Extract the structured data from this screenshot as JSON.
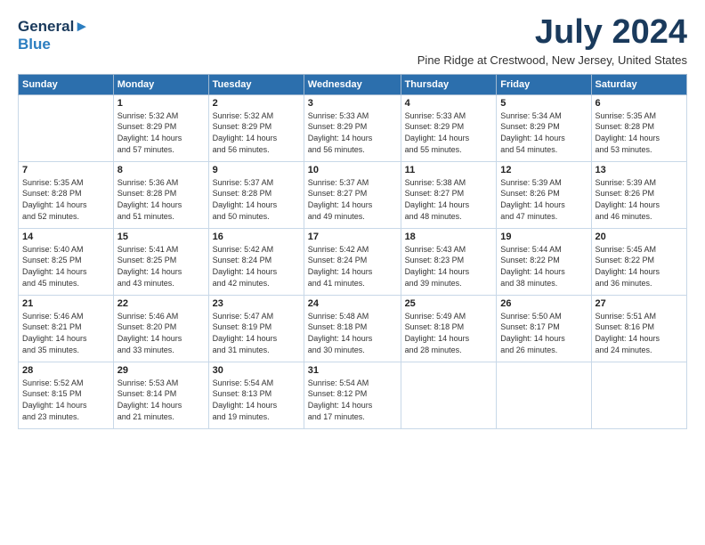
{
  "header": {
    "logo_line1": "General",
    "logo_line2": "Blue",
    "month_year": "July 2024",
    "subtitle": "Pine Ridge at Crestwood, New Jersey, United States"
  },
  "days_of_week": [
    "Sunday",
    "Monday",
    "Tuesday",
    "Wednesday",
    "Thursday",
    "Friday",
    "Saturday"
  ],
  "weeks": [
    [
      {
        "day": "",
        "text": ""
      },
      {
        "day": "1",
        "text": "Sunrise: 5:32 AM\nSunset: 8:29 PM\nDaylight: 14 hours\nand 57 minutes."
      },
      {
        "day": "2",
        "text": "Sunrise: 5:32 AM\nSunset: 8:29 PM\nDaylight: 14 hours\nand 56 minutes."
      },
      {
        "day": "3",
        "text": "Sunrise: 5:33 AM\nSunset: 8:29 PM\nDaylight: 14 hours\nand 56 minutes."
      },
      {
        "day": "4",
        "text": "Sunrise: 5:33 AM\nSunset: 8:29 PM\nDaylight: 14 hours\nand 55 minutes."
      },
      {
        "day": "5",
        "text": "Sunrise: 5:34 AM\nSunset: 8:29 PM\nDaylight: 14 hours\nand 54 minutes."
      },
      {
        "day": "6",
        "text": "Sunrise: 5:35 AM\nSunset: 8:28 PM\nDaylight: 14 hours\nand 53 minutes."
      }
    ],
    [
      {
        "day": "7",
        "text": "Sunrise: 5:35 AM\nSunset: 8:28 PM\nDaylight: 14 hours\nand 52 minutes."
      },
      {
        "day": "8",
        "text": "Sunrise: 5:36 AM\nSunset: 8:28 PM\nDaylight: 14 hours\nand 51 minutes."
      },
      {
        "day": "9",
        "text": "Sunrise: 5:37 AM\nSunset: 8:28 PM\nDaylight: 14 hours\nand 50 minutes."
      },
      {
        "day": "10",
        "text": "Sunrise: 5:37 AM\nSunset: 8:27 PM\nDaylight: 14 hours\nand 49 minutes."
      },
      {
        "day": "11",
        "text": "Sunrise: 5:38 AM\nSunset: 8:27 PM\nDaylight: 14 hours\nand 48 minutes."
      },
      {
        "day": "12",
        "text": "Sunrise: 5:39 AM\nSunset: 8:26 PM\nDaylight: 14 hours\nand 47 minutes."
      },
      {
        "day": "13",
        "text": "Sunrise: 5:39 AM\nSunset: 8:26 PM\nDaylight: 14 hours\nand 46 minutes."
      }
    ],
    [
      {
        "day": "14",
        "text": "Sunrise: 5:40 AM\nSunset: 8:25 PM\nDaylight: 14 hours\nand 45 minutes."
      },
      {
        "day": "15",
        "text": "Sunrise: 5:41 AM\nSunset: 8:25 PM\nDaylight: 14 hours\nand 43 minutes."
      },
      {
        "day": "16",
        "text": "Sunrise: 5:42 AM\nSunset: 8:24 PM\nDaylight: 14 hours\nand 42 minutes."
      },
      {
        "day": "17",
        "text": "Sunrise: 5:42 AM\nSunset: 8:24 PM\nDaylight: 14 hours\nand 41 minutes."
      },
      {
        "day": "18",
        "text": "Sunrise: 5:43 AM\nSunset: 8:23 PM\nDaylight: 14 hours\nand 39 minutes."
      },
      {
        "day": "19",
        "text": "Sunrise: 5:44 AM\nSunset: 8:22 PM\nDaylight: 14 hours\nand 38 minutes."
      },
      {
        "day": "20",
        "text": "Sunrise: 5:45 AM\nSunset: 8:22 PM\nDaylight: 14 hours\nand 36 minutes."
      }
    ],
    [
      {
        "day": "21",
        "text": "Sunrise: 5:46 AM\nSunset: 8:21 PM\nDaylight: 14 hours\nand 35 minutes."
      },
      {
        "day": "22",
        "text": "Sunrise: 5:46 AM\nSunset: 8:20 PM\nDaylight: 14 hours\nand 33 minutes."
      },
      {
        "day": "23",
        "text": "Sunrise: 5:47 AM\nSunset: 8:19 PM\nDaylight: 14 hours\nand 31 minutes."
      },
      {
        "day": "24",
        "text": "Sunrise: 5:48 AM\nSunset: 8:18 PM\nDaylight: 14 hours\nand 30 minutes."
      },
      {
        "day": "25",
        "text": "Sunrise: 5:49 AM\nSunset: 8:18 PM\nDaylight: 14 hours\nand 28 minutes."
      },
      {
        "day": "26",
        "text": "Sunrise: 5:50 AM\nSunset: 8:17 PM\nDaylight: 14 hours\nand 26 minutes."
      },
      {
        "day": "27",
        "text": "Sunrise: 5:51 AM\nSunset: 8:16 PM\nDaylight: 14 hours\nand 24 minutes."
      }
    ],
    [
      {
        "day": "28",
        "text": "Sunrise: 5:52 AM\nSunset: 8:15 PM\nDaylight: 14 hours\nand 23 minutes."
      },
      {
        "day": "29",
        "text": "Sunrise: 5:53 AM\nSunset: 8:14 PM\nDaylight: 14 hours\nand 21 minutes."
      },
      {
        "day": "30",
        "text": "Sunrise: 5:54 AM\nSunset: 8:13 PM\nDaylight: 14 hours\nand 19 minutes."
      },
      {
        "day": "31",
        "text": "Sunrise: 5:54 AM\nSunset: 8:12 PM\nDaylight: 14 hours\nand 17 minutes."
      },
      {
        "day": "",
        "text": ""
      },
      {
        "day": "",
        "text": ""
      },
      {
        "day": "",
        "text": ""
      }
    ]
  ]
}
